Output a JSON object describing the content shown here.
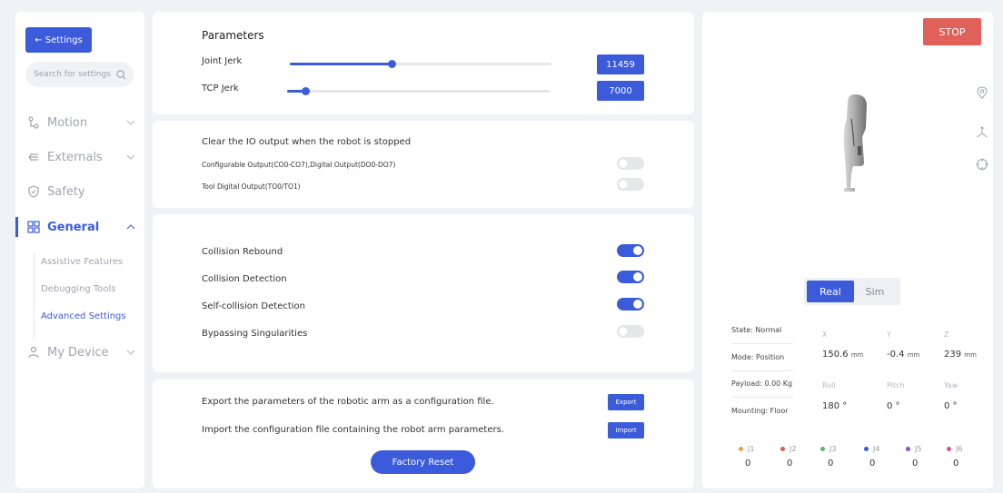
{
  "sidebar": {
    "back_label": "← Settings",
    "search_placeholder": "Search for settings",
    "items": [
      {
        "label": "Motion"
      },
      {
        "label": "Externals"
      },
      {
        "label": "Safety"
      },
      {
        "label": "General"
      },
      {
        "label": "My Device"
      }
    ],
    "general_sub": [
      "Assistive Features",
      "Debugging Tools",
      "Advanced Settings"
    ]
  },
  "parameters": {
    "title": "Parameters",
    "joint_jerk_label": "Joint Jerk",
    "joint_jerk_value": "11459",
    "joint_jerk_fraction": 0.39,
    "tcp_jerk_label": "TCP Jerk",
    "tcp_jerk_value": "7000",
    "tcp_jerk_fraction": 0.07
  },
  "io": {
    "title": "Clear the IO output when the robot is stopped",
    "configurable_label": "Configurable Output(CO0-CO7),Digital Output(DO0-DO7)",
    "configurable_on": false,
    "tool_label": "Tool Digital Output(TO0/TO1)",
    "tool_on": false
  },
  "collision": {
    "items": [
      {
        "label": "Collision Rebound",
        "on": true
      },
      {
        "label": "Collision Detection",
        "on": true
      },
      {
        "label": "Self-collision Detection",
        "on": true
      },
      {
        "label": "Bypassing Singularities",
        "on": false
      }
    ]
  },
  "config": {
    "export_text": "Export the parameters of the robotic arm as a configuration file.",
    "export_btn": "Export",
    "import_text": "Import the configuration file containing the robot arm parameters.",
    "import_btn": "Import",
    "factory_reset": "Factory Reset"
  },
  "robot": {
    "stop_label": "STOP",
    "mode_real": "Real",
    "mode_sim": "Sim",
    "state": "State: Normal",
    "mode": "Mode: Position",
    "payload": "Payload: 0.00 Kg",
    "mounting": "Mounting: Floor",
    "x_label": "X",
    "y_label": "Y",
    "z_label": "Z",
    "x_val": "150.6",
    "y_val": "-0.4",
    "z_val": "239",
    "unit_mm": "mm",
    "roll_label": "Roll",
    "pitch_label": "Pitch",
    "yaw_label": "Yaw",
    "roll_val": "180 °",
    "pitch_val": "0 °",
    "yaw_val": "0 °",
    "joints": [
      {
        "label": "J1",
        "value": "0",
        "color": "#e8a045"
      },
      {
        "label": "J2",
        "value": "0",
        "color": "#e05555"
      },
      {
        "label": "J3",
        "value": "0",
        "color": "#5ab86a"
      },
      {
        "label": "J4",
        "value": "0",
        "color": "#3b5bdb"
      },
      {
        "label": "J5",
        "value": "0",
        "color": "#8a4fd8"
      },
      {
        "label": "J6",
        "value": "0",
        "color": "#d84f9c"
      }
    ]
  }
}
